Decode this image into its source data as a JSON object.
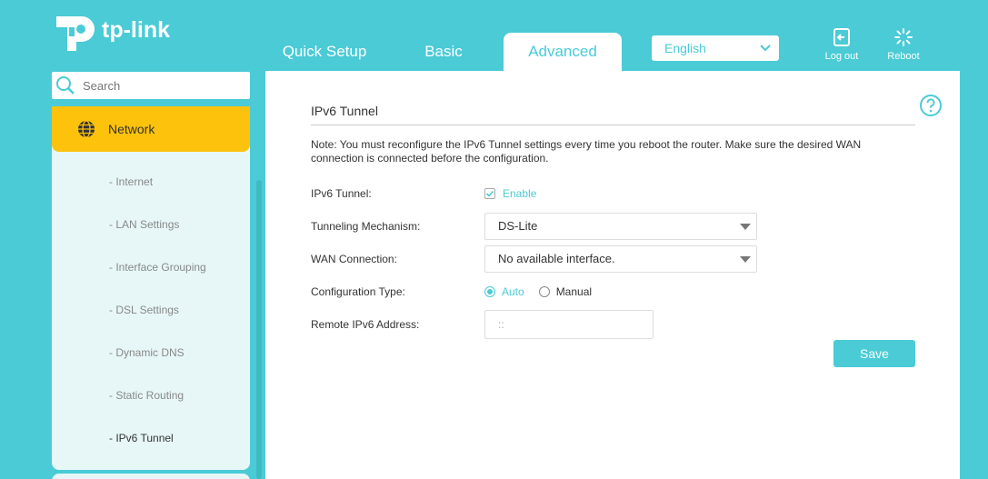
{
  "header": {
    "logo_text": "tp-link",
    "tabs": [
      {
        "label": "Quick Setup"
      },
      {
        "label": "Basic"
      },
      {
        "label": "Advanced"
      }
    ],
    "language": "English",
    "logout_label": "Log out",
    "reboot_label": "Reboot"
  },
  "sidebar": {
    "search_placeholder": "Search",
    "section": "Network",
    "items": [
      {
        "label": "- Internet"
      },
      {
        "label": "- LAN Settings"
      },
      {
        "label": "- Interface Grouping"
      },
      {
        "label": "- DSL Settings"
      },
      {
        "label": "- Dynamic DNS"
      },
      {
        "label": "- Static Routing"
      },
      {
        "label": "- IPv6 Tunnel"
      }
    ]
  },
  "main": {
    "title": "IPv6 Tunnel",
    "note": "Note: You must reconfigure the IPv6 Tunnel settings every time you reboot the router. Make sure the desired WAN connection is connected before the configuration.",
    "fields": {
      "tunnel_label": "IPv6 Tunnel:",
      "tunnel_enable": "Enable",
      "mechanism_label": "Tunneling Mechanism:",
      "mechanism_value": "DS-Lite",
      "wan_label": "WAN Connection:",
      "wan_value": "No available interface.",
      "config_label": "Configuration Type:",
      "config_auto": "Auto",
      "config_manual": "Manual",
      "remote_label": "Remote IPv6 Address:",
      "remote_placeholder": "::"
    },
    "save_label": "Save"
  },
  "colors": {
    "brand": "#4acbd6",
    "highlight": "#fdc20c"
  }
}
